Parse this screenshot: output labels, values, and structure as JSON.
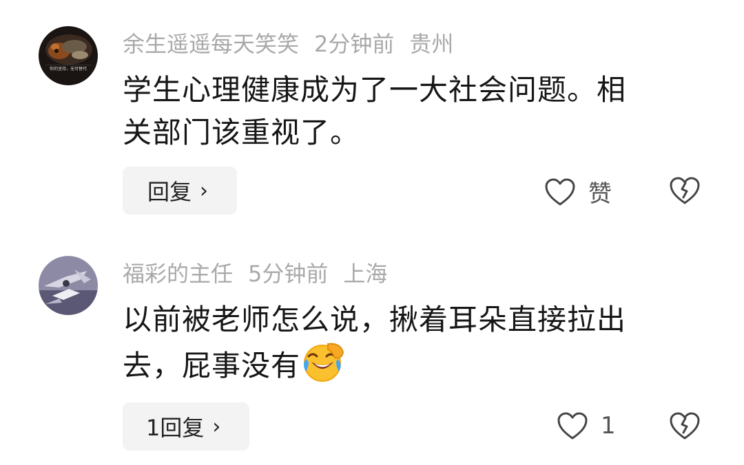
{
  "comments": [
    {
      "username": "余生遥遥每天笑笑",
      "time": "2分钟前",
      "location": "贵州",
      "line1": "学生心理健康成为了一大社会问题。相",
      "line2": "关部门该重视了。",
      "reply_label": "回复",
      "like_label": "赞",
      "avatar_caption": "你的坚持，无可替代"
    },
    {
      "username": "福彩的主任",
      "time": "5分钟前",
      "location": "上海",
      "line1": "以前被老师怎么说，揪着耳朵直接拉出",
      "line2": "去，屁事没有",
      "emoji": "laughing-crying-emoji",
      "reply_label": "1回复",
      "like_label": "1"
    }
  ],
  "icons": {
    "chevron": "›",
    "like": "heart-icon",
    "dislike": "broken-heart-icon"
  },
  "colors": {
    "meta_text": "#a9a9a9",
    "body_text": "#161616",
    "reply_bg": "#f3f3f3"
  }
}
